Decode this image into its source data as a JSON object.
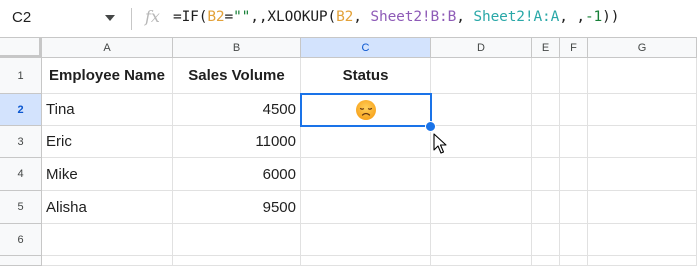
{
  "formula_bar": {
    "cell_ref": "C2",
    "fx_label": "fx",
    "formula_parts": {
      "p1": "=IF(",
      "p2": "B2",
      "p3": "=",
      "p4": "\"\"",
      "p5": ",,XLOOKUP(",
      "p6": "B2",
      "p7": ", ",
      "p8": "Sheet2!B:B",
      "p9": ", ",
      "p10": "Sheet2!A:A",
      "p11": ", ,",
      "p12": "-1",
      "p13": "))"
    }
  },
  "columns": [
    "A",
    "B",
    "C",
    "D",
    "E",
    "F",
    "G"
  ],
  "selected_column": "C",
  "rows": [
    "1",
    "2",
    "3",
    "4",
    "5",
    "6"
  ],
  "selected_row": "2",
  "table": {
    "headers": [
      "Employee Name",
      "Sales Volume",
      "Status"
    ],
    "data": [
      {
        "name": "Tina",
        "sales": "4500",
        "status_icon": "disappointed-face-emoji"
      },
      {
        "name": "Eric",
        "sales": "11000"
      },
      {
        "name": "Mike",
        "sales": "6000"
      },
      {
        "name": "Alisha",
        "sales": "9500"
      }
    ]
  },
  "colors": {
    "selection": "#1a73e8",
    "header_selected_bg": "#d3e3fd",
    "ref_b2": "#e3a23a",
    "ref_sheet2_b": "#8e5bb7",
    "ref_sheet2_a": "#2aa8a8",
    "literal": "#188038"
  }
}
